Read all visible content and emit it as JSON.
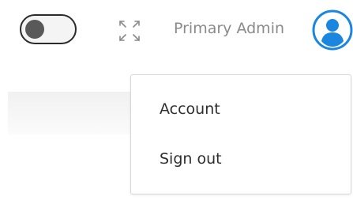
{
  "header": {
    "theme_toggle": {
      "state": "off"
    },
    "fullscreen": {
      "icon": "fullscreen-expand-icon"
    },
    "admin_name": "Primary Admin",
    "avatar": {
      "icon": "user-avatar-icon",
      "color": "#1a86e0"
    }
  },
  "dropdown": {
    "items": [
      {
        "label": "Account"
      },
      {
        "label": "Sign out"
      }
    ]
  }
}
